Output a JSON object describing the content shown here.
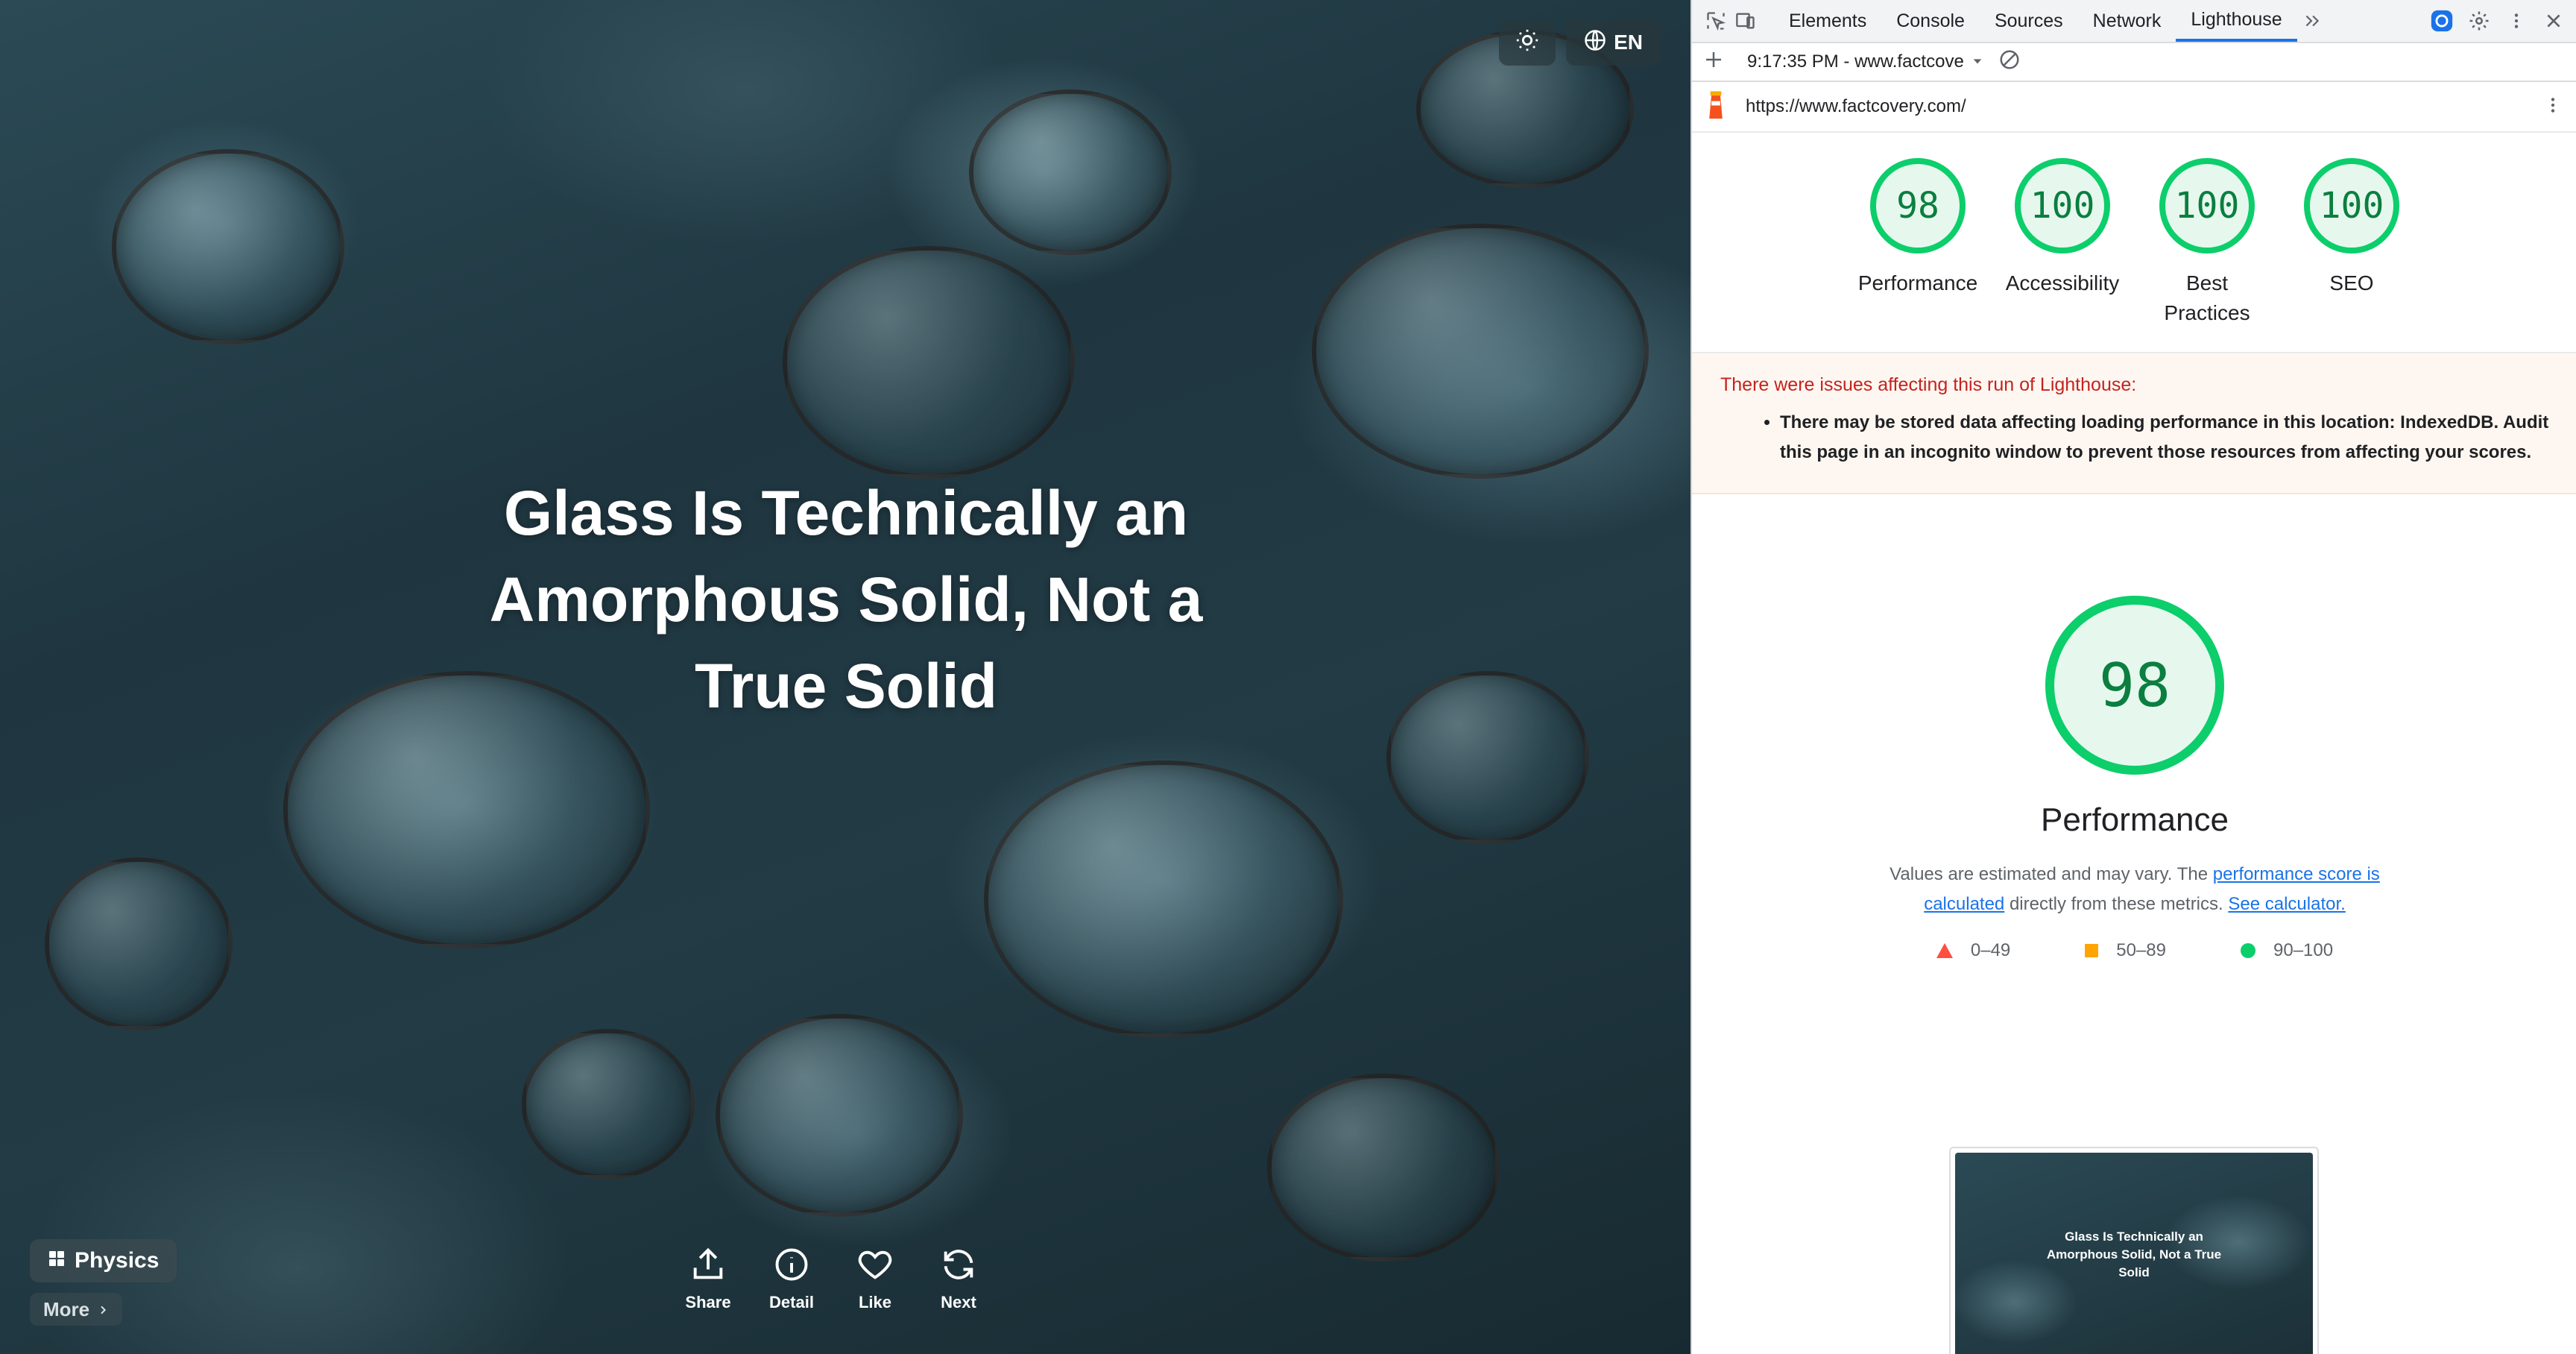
{
  "page": {
    "headline": "Glass Is Technically an Amorphous Solid, Not a True Solid",
    "language_label": "EN",
    "category_label": "Physics",
    "more_label": "More",
    "actions": [
      {
        "label": "Share",
        "icon": "share-icon"
      },
      {
        "label": "Detail",
        "icon": "info-icon"
      },
      {
        "label": "Like",
        "icon": "heart-icon"
      },
      {
        "label": "Next",
        "icon": "refresh-icon"
      }
    ]
  },
  "devtools": {
    "tabs": [
      "Elements",
      "Console",
      "Sources",
      "Network",
      "Lighthouse"
    ],
    "active_tab": "Lighthouse",
    "run_label": "9:17:35 PM - www.factcove",
    "url": "https://www.factcovery.com/",
    "scores": [
      {
        "value": "98",
        "label": "Performance"
      },
      {
        "value": "100",
        "label": "Accessibility"
      },
      {
        "value": "100",
        "label": "Best Practices"
      },
      {
        "value": "100",
        "label": "SEO"
      }
    ],
    "warning_title": "There were issues affecting this run of Lighthouse:",
    "warning_item": "There may be stored data affecting loading performance in this location: IndexedDB. Audit this page in an incognito window to prevent those resources from affecting your scores.",
    "performance": {
      "score": "98",
      "title": "Performance",
      "desc_prefix": "Values are estimated and may vary. The ",
      "desc_link1": "performance score is calculated",
      "desc_middle": " directly from these metrics. ",
      "desc_link2": "See calculator."
    },
    "legend": [
      {
        "range": "0–49",
        "color": "#ff4e42"
      },
      {
        "range": "50–89",
        "color": "#ffa400"
      },
      {
        "range": "90–100",
        "color": "#0cce6b"
      }
    ],
    "thumbnail_text": "Glass Is Technically an Amorphous Solid, Not a True Solid"
  }
}
